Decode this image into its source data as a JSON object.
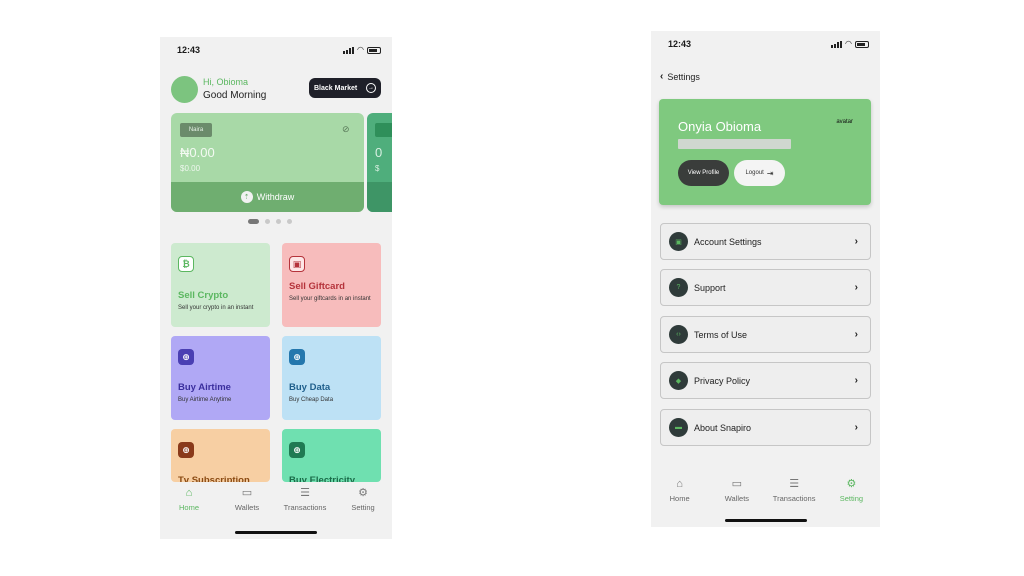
{
  "home": {
    "status_time": "12:43",
    "greeting_hi": "Hi, Obioma",
    "greeting_time": "Good Morning",
    "black_market_label": "Black Market",
    "wallet": {
      "tag": "Naira",
      "balance": "₦0.00",
      "usd": "$0.00",
      "withdraw_label": "Withdraw",
      "second_card_balance": "0",
      "second_card_usd": "$"
    },
    "tiles": [
      {
        "title": "Sell Crypto",
        "subtitle": "Sell your crypto in an instant",
        "bg": "#cdeacf",
        "title_color": "#5bb760",
        "icon_bg": "#ffffff",
        "icon_color": "#5bb760",
        "icon": "crypto-icon",
        "glyph": "₿"
      },
      {
        "title": "Sell Giftcard",
        "subtitle": "Sell your giftcards in an instant",
        "bg": "#f7bcbc",
        "title_color": "#b5333b",
        "icon_bg": "#fde6e6",
        "icon_color": "#b5333b",
        "icon": "giftcard-icon",
        "glyph": "▣"
      },
      {
        "title": "Buy Airtime",
        "subtitle": "Buy Airtime Anytime",
        "bg": "#b0a8f5",
        "title_color": "#3b2f9e",
        "icon_bg": "#4a3fb3",
        "icon_color": "#ffffff",
        "icon": "airtime-icon",
        "glyph": "⊕"
      },
      {
        "title": "Buy Data",
        "subtitle": "Buy Cheap Data",
        "bg": "#bde1f5",
        "title_color": "#1f5f8c",
        "icon_bg": "#2477ad",
        "icon_color": "#ffffff",
        "icon": "data-icon",
        "glyph": "⊕"
      },
      {
        "title": "Tv Subscription",
        "subtitle": "",
        "bg": "#f7cfa3",
        "title_color": "#8a4a12",
        "icon_bg": "#8a3a1a",
        "icon_color": "#ffffff",
        "icon": "tv-icon",
        "glyph": "⊕"
      },
      {
        "title": "Buy Electricity",
        "subtitle": "",
        "bg": "#6fe0b0",
        "title_color": "#1a6b48",
        "icon_bg": "#1f7a53",
        "icon_color": "#ffffff",
        "icon": "electricity-icon",
        "glyph": "⊕"
      }
    ],
    "tabs": [
      {
        "label": "Home",
        "icon": "home-icon",
        "glyph": "⌂",
        "active": true
      },
      {
        "label": "Wallets",
        "icon": "wallet-icon",
        "glyph": "▭",
        "active": false
      },
      {
        "label": "Transactions",
        "icon": "list-icon",
        "glyph": "☰",
        "active": false
      },
      {
        "label": "Setting",
        "icon": "gear-icon",
        "glyph": "⚙",
        "active": false
      }
    ]
  },
  "settings": {
    "status_time": "12:43",
    "header_title": "Settings",
    "profile": {
      "name": "Onyia Obioma",
      "avatar_text": "avatar",
      "view_profile_label": "View Profile",
      "logout_label": "Logout"
    },
    "menu": [
      {
        "label": "Account Settings",
        "icon": "account-icon",
        "glyph": "▣"
      },
      {
        "label": "Support",
        "icon": "support-icon",
        "glyph": "?"
      },
      {
        "label": "Terms of Use",
        "icon": "terms-icon",
        "glyph": "‹›"
      },
      {
        "label": "Privacy Policy",
        "icon": "privacy-icon",
        "glyph": "◆"
      },
      {
        "label": "About Snapiro",
        "icon": "about-icon",
        "glyph": "▬"
      }
    ],
    "tabs": [
      {
        "label": "Home",
        "icon": "home-icon",
        "glyph": "⌂",
        "active": false
      },
      {
        "label": "Wallets",
        "icon": "wallet-icon",
        "glyph": "▭",
        "active": false
      },
      {
        "label": "Transactions",
        "icon": "list-icon",
        "glyph": "☰",
        "active": false
      },
      {
        "label": "Setting",
        "icon": "gear-icon",
        "glyph": "⚙",
        "active": true
      }
    ]
  }
}
